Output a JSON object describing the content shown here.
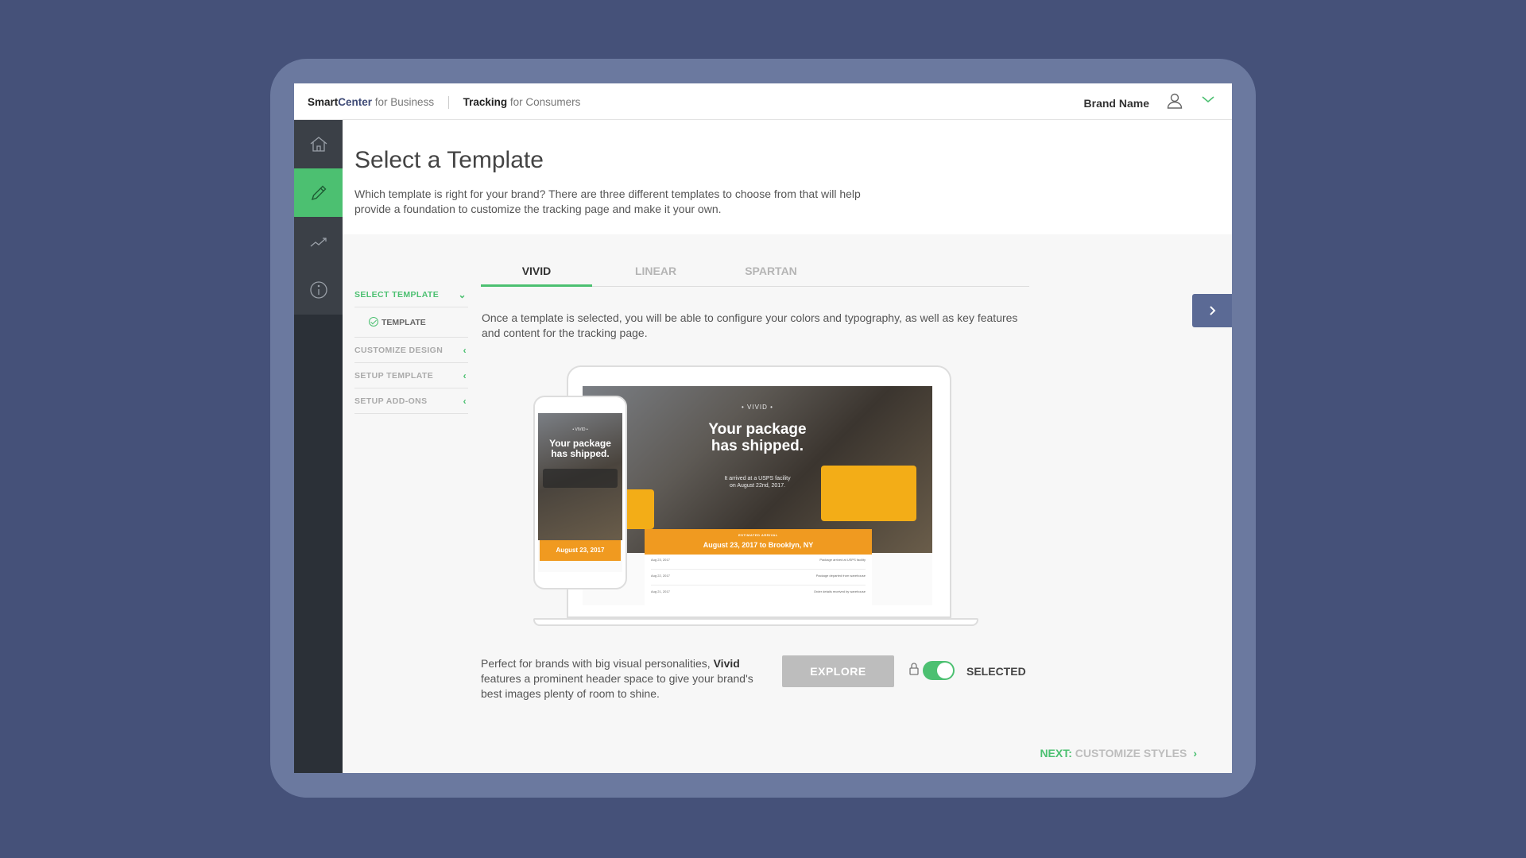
{
  "header": {
    "smartcenter_bold": "Smart",
    "smartcenter_blue": "Center",
    "smartcenter_suffix": " for Business",
    "tracking_bold": "Tracking",
    "tracking_suffix": " for Consumers",
    "brand_name": "Brand Name"
  },
  "sidebar": {
    "items": [
      {
        "icon": "home-icon"
      },
      {
        "icon": "pencil-icon",
        "active": true
      },
      {
        "icon": "analytics-icon"
      },
      {
        "icon": "info-icon"
      }
    ]
  },
  "page": {
    "title": "Select a Template",
    "description": "Which template is right for your brand? There are three different templates to choose from that will help provide a foundation to customize the tracking page and make it your own."
  },
  "steps": {
    "select_template": "SELECT TEMPLATE",
    "template": "TEMPLATE",
    "customize_design": "CUSTOMIZE DESIGN",
    "setup_template": "SETUP TEMPLATE",
    "setup_addons": "SETUP ADD-ONS"
  },
  "tabs": [
    {
      "label": "VIVID",
      "active": true
    },
    {
      "label": "LINEAR"
    },
    {
      "label": "SPARTAN"
    }
  ],
  "template_description": "Once a template is selected, you will be able to configure your colors and typography, as well as key features and content for the tracking page.",
  "preview": {
    "brand": "• VIVID •",
    "headline_1": "Your package",
    "headline_2": "has shipped.",
    "status_1": "It arrived at a USPS facility",
    "status_2": "on August 22nd, 2017.",
    "arrival_label": "ESTIMATED ARRIVAL",
    "arrival": "August 23, 2017 to Brooklyn, NY",
    "phone_arrival": "August 23, 2017",
    "rows": [
      {
        "date": "Aug 23, 2017",
        "event": "Package arrived at USPS facility"
      },
      {
        "date": "Aug 22, 2017",
        "event": "Package departed from warehouse"
      },
      {
        "date": "Aug 21, 2017",
        "event": "Order details received by warehouse"
      }
    ]
  },
  "bottom": {
    "blurb_1": "Perfect for brands with big visual personalities, ",
    "blurb_bold": "Vivid",
    "blurb_2": " features a prominent header space to give your brand's best images plenty of room to shine.",
    "explore": "EXPLORE",
    "selected": "SELECTED",
    "toggle_on": true
  },
  "next": {
    "prefix": "NEXT:",
    "label": " CUSTOMIZE STYLES"
  },
  "colors": {
    "accent": "#4cc071",
    "background": "#455179",
    "sidebar": "#2b3037",
    "orange": "#f09a20"
  }
}
